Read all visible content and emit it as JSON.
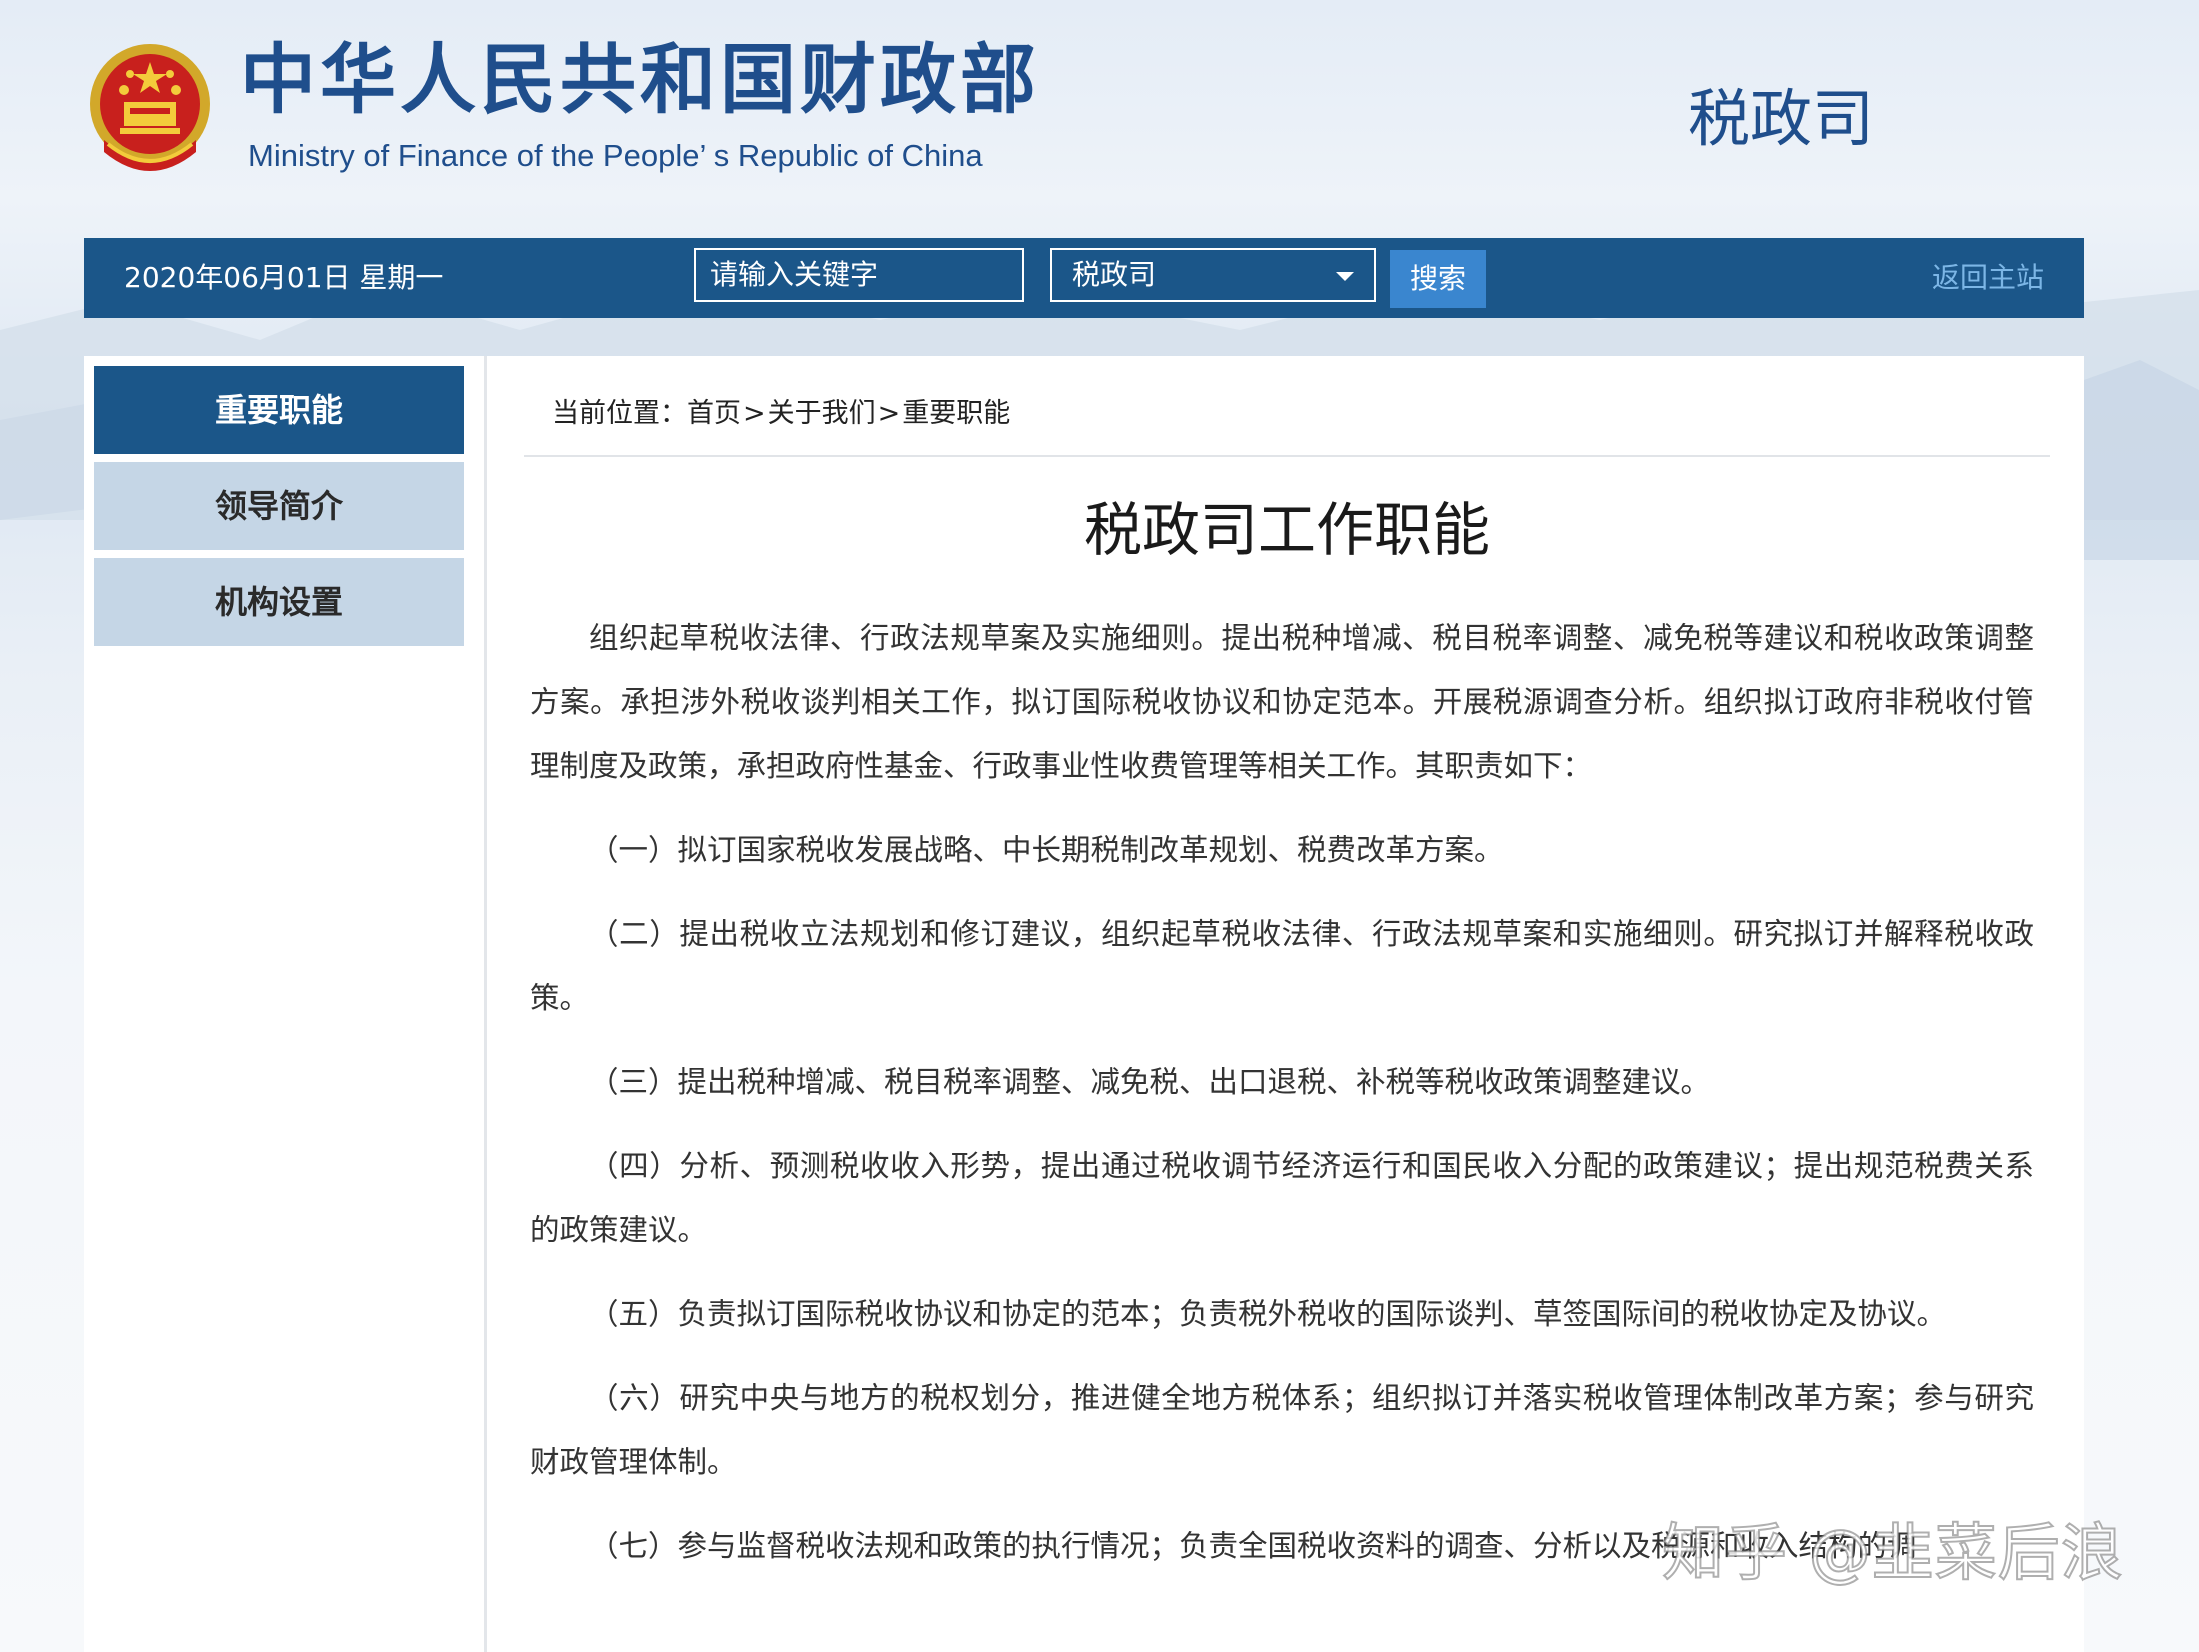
{
  "header": {
    "site_title_cn": "中华人民共和国财政部",
    "site_title_en": "Ministry of Finance of the People’ s Republic of China",
    "department": "税政司",
    "emblem_icon": "national-emblem-icon"
  },
  "navbar": {
    "date": "2020年06月01日  星期一",
    "search_placeholder": "请输入关键字",
    "scope_selected": "税政司",
    "search_button": "搜索",
    "home_link": "返回主站",
    "bar_color": "#1b5689"
  },
  "sidebar": {
    "items": [
      {
        "label": "重要职能",
        "active": true
      },
      {
        "label": "领导简介",
        "active": false
      },
      {
        "label": "机构设置",
        "active": false
      }
    ]
  },
  "breadcrumb": {
    "prefix": "当前位置：",
    "items": [
      "首页",
      "关于我们",
      "重要职能"
    ],
    "separator": ">"
  },
  "article": {
    "title": "税政司工作职能",
    "intro": "组织起草税收法律、行政法规草案及实施细则。提出税种增减、税目税率调整、减免税等建议和税收政策调整方案。承担涉外税收谈判相关工作，拟订国际税收协议和协定范本。开展税源调查分析。组织拟订政府非税收付管理制度及政策，承担政府性基金、行政事业性收费管理等相关工作。其职责如下：",
    "duties": [
      "（一）拟订国家税收发展战略、中长期税制改革规划、税费改革方案。",
      "（二）提出税收立法规划和修订建议，组织起草税收法律、行政法规草案和实施细则。研究拟订并解释税收政策。",
      "（三）提出税种增减、税目税率调整、减免税、出口退税、补税等税收政策调整建议。",
      "（四）分析、预测税收收入形势，提出通过税收调节经济运行和国民收入分配的政策建议；提出规范税费关系的政策建议。",
      "（五）负责拟订国际税收协议和协定的范本；负责税外税收的国际谈判、草签国际间的税收协定及协议。",
      "（六）研究中央与地方的税权划分，推进健全地方税体系；组织拟订并落实税收管理体制改革方案；参与研究财政管理体制。",
      "（七）参与监督税收法规和政策的执行情况；负责全国税收资料的调查、分析以及税源和收入结构的调"
    ]
  },
  "watermark": "知乎 @韭菜后浪"
}
